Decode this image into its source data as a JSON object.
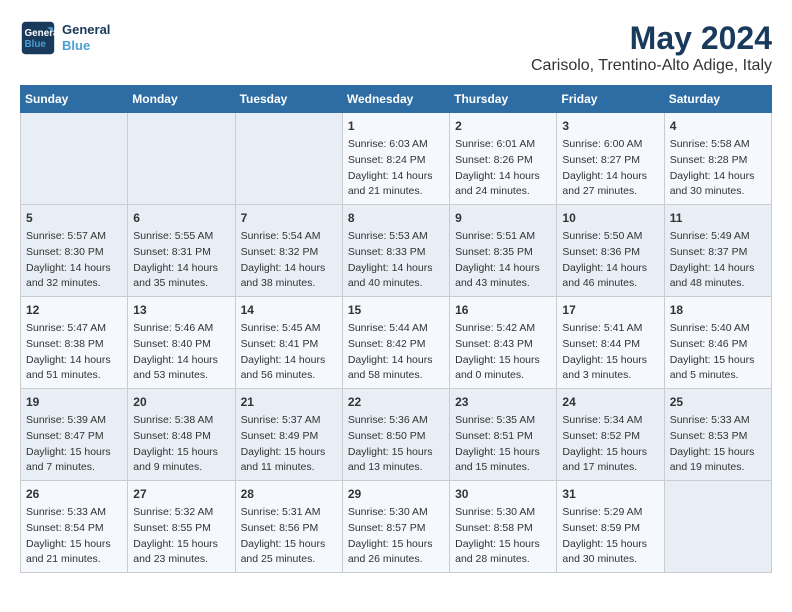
{
  "header": {
    "logo_line1": "General",
    "logo_line2": "Blue",
    "title": "May 2024",
    "subtitle": "Carisolo, Trentino-Alto Adige, Italy"
  },
  "weekdays": [
    "Sunday",
    "Monday",
    "Tuesday",
    "Wednesday",
    "Thursday",
    "Friday",
    "Saturday"
  ],
  "weeks": [
    [
      {
        "day": "",
        "content": ""
      },
      {
        "day": "",
        "content": ""
      },
      {
        "day": "",
        "content": ""
      },
      {
        "day": "1",
        "content": "Sunrise: 6:03 AM\nSunset: 8:24 PM\nDaylight: 14 hours\nand 21 minutes."
      },
      {
        "day": "2",
        "content": "Sunrise: 6:01 AM\nSunset: 8:26 PM\nDaylight: 14 hours\nand 24 minutes."
      },
      {
        "day": "3",
        "content": "Sunrise: 6:00 AM\nSunset: 8:27 PM\nDaylight: 14 hours\nand 27 minutes."
      },
      {
        "day": "4",
        "content": "Sunrise: 5:58 AM\nSunset: 8:28 PM\nDaylight: 14 hours\nand 30 minutes."
      }
    ],
    [
      {
        "day": "5",
        "content": "Sunrise: 5:57 AM\nSunset: 8:30 PM\nDaylight: 14 hours\nand 32 minutes."
      },
      {
        "day": "6",
        "content": "Sunrise: 5:55 AM\nSunset: 8:31 PM\nDaylight: 14 hours\nand 35 minutes."
      },
      {
        "day": "7",
        "content": "Sunrise: 5:54 AM\nSunset: 8:32 PM\nDaylight: 14 hours\nand 38 minutes."
      },
      {
        "day": "8",
        "content": "Sunrise: 5:53 AM\nSunset: 8:33 PM\nDaylight: 14 hours\nand 40 minutes."
      },
      {
        "day": "9",
        "content": "Sunrise: 5:51 AM\nSunset: 8:35 PM\nDaylight: 14 hours\nand 43 minutes."
      },
      {
        "day": "10",
        "content": "Sunrise: 5:50 AM\nSunset: 8:36 PM\nDaylight: 14 hours\nand 46 minutes."
      },
      {
        "day": "11",
        "content": "Sunrise: 5:49 AM\nSunset: 8:37 PM\nDaylight: 14 hours\nand 48 minutes."
      }
    ],
    [
      {
        "day": "12",
        "content": "Sunrise: 5:47 AM\nSunset: 8:38 PM\nDaylight: 14 hours\nand 51 minutes."
      },
      {
        "day": "13",
        "content": "Sunrise: 5:46 AM\nSunset: 8:40 PM\nDaylight: 14 hours\nand 53 minutes."
      },
      {
        "day": "14",
        "content": "Sunrise: 5:45 AM\nSunset: 8:41 PM\nDaylight: 14 hours\nand 56 minutes."
      },
      {
        "day": "15",
        "content": "Sunrise: 5:44 AM\nSunset: 8:42 PM\nDaylight: 14 hours\nand 58 minutes."
      },
      {
        "day": "16",
        "content": "Sunrise: 5:42 AM\nSunset: 8:43 PM\nDaylight: 15 hours\nand 0 minutes."
      },
      {
        "day": "17",
        "content": "Sunrise: 5:41 AM\nSunset: 8:44 PM\nDaylight: 15 hours\nand 3 minutes."
      },
      {
        "day": "18",
        "content": "Sunrise: 5:40 AM\nSunset: 8:46 PM\nDaylight: 15 hours\nand 5 minutes."
      }
    ],
    [
      {
        "day": "19",
        "content": "Sunrise: 5:39 AM\nSunset: 8:47 PM\nDaylight: 15 hours\nand 7 minutes."
      },
      {
        "day": "20",
        "content": "Sunrise: 5:38 AM\nSunset: 8:48 PM\nDaylight: 15 hours\nand 9 minutes."
      },
      {
        "day": "21",
        "content": "Sunrise: 5:37 AM\nSunset: 8:49 PM\nDaylight: 15 hours\nand 11 minutes."
      },
      {
        "day": "22",
        "content": "Sunrise: 5:36 AM\nSunset: 8:50 PM\nDaylight: 15 hours\nand 13 minutes."
      },
      {
        "day": "23",
        "content": "Sunrise: 5:35 AM\nSunset: 8:51 PM\nDaylight: 15 hours\nand 15 minutes."
      },
      {
        "day": "24",
        "content": "Sunrise: 5:34 AM\nSunset: 8:52 PM\nDaylight: 15 hours\nand 17 minutes."
      },
      {
        "day": "25",
        "content": "Sunrise: 5:33 AM\nSunset: 8:53 PM\nDaylight: 15 hours\nand 19 minutes."
      }
    ],
    [
      {
        "day": "26",
        "content": "Sunrise: 5:33 AM\nSunset: 8:54 PM\nDaylight: 15 hours\nand 21 minutes."
      },
      {
        "day": "27",
        "content": "Sunrise: 5:32 AM\nSunset: 8:55 PM\nDaylight: 15 hours\nand 23 minutes."
      },
      {
        "day": "28",
        "content": "Sunrise: 5:31 AM\nSunset: 8:56 PM\nDaylight: 15 hours\nand 25 minutes."
      },
      {
        "day": "29",
        "content": "Sunrise: 5:30 AM\nSunset: 8:57 PM\nDaylight: 15 hours\nand 26 minutes."
      },
      {
        "day": "30",
        "content": "Sunrise: 5:30 AM\nSunset: 8:58 PM\nDaylight: 15 hours\nand 28 minutes."
      },
      {
        "day": "31",
        "content": "Sunrise: 5:29 AM\nSunset: 8:59 PM\nDaylight: 15 hours\nand 30 minutes."
      },
      {
        "day": "",
        "content": ""
      }
    ]
  ]
}
